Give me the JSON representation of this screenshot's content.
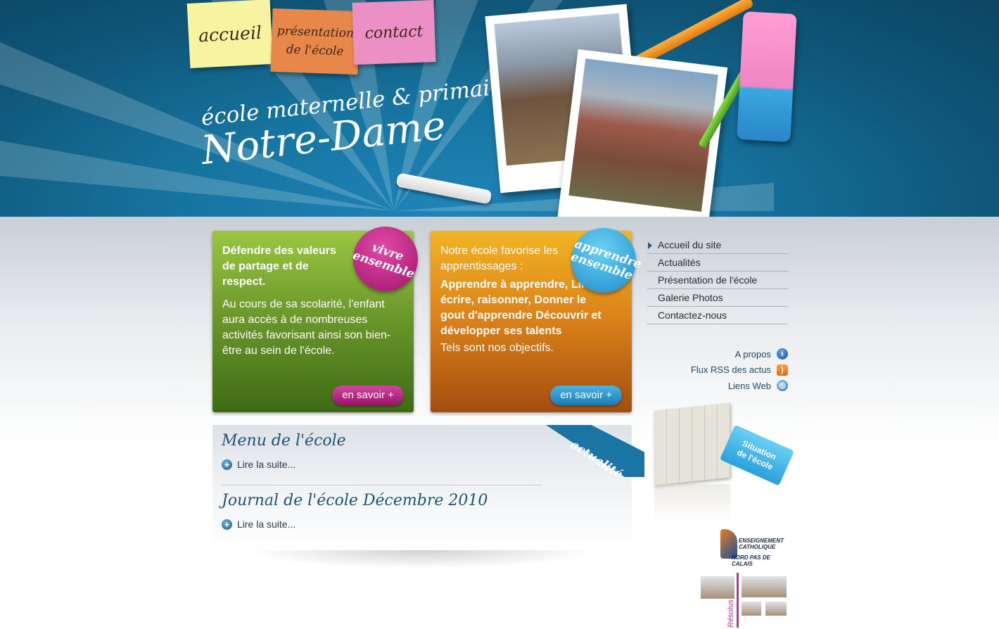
{
  "nav_notes": [
    {
      "label": "accueil"
    },
    {
      "label_line1": "présentation",
      "label_line2": "de l'école"
    },
    {
      "label": "contact"
    }
  ],
  "header": {
    "title_line1": "école maternelle & primaire",
    "title_line2": "Notre-Dame"
  },
  "features": {
    "green": {
      "seal_line1": "vivre",
      "seal_line2": "ensemble",
      "heading": "Défendre des valeurs de partage et de respect.",
      "body": "Au cours de sa scolarité, l'enfant aura accès à de nombreuses activités favorisant ainsi son bien-être au sein de l'école.",
      "button": "en savoir +"
    },
    "orange": {
      "seal_line1": "apprendre",
      "seal_line2": "ensemble",
      "intro": "Notre école favorise les apprentissages :",
      "points": "Apprendre à apprendre, Lire, écrire, raisonner, Donner le gout d'apprendre Découvrir et développer ses talents",
      "tail": "Tels sont nos objectifs.",
      "button": "en savoir +"
    }
  },
  "news": {
    "ribbon": "actualité",
    "items": [
      {
        "title": "Menu de l'école",
        "more": "Lire la suite..."
      },
      {
        "title": "Journal de l'école Décembre 2010",
        "more": "Lire la suite..."
      }
    ]
  },
  "sidebar": {
    "nav": [
      {
        "label": "Accueil du site"
      },
      {
        "label": "Actualités"
      },
      {
        "label": "Présentation de l'école"
      },
      {
        "label": "Galerie Photos"
      },
      {
        "label": "Contactez-nous"
      }
    ],
    "links": [
      {
        "label": "A propos",
        "icon": "info-icon"
      },
      {
        "label": "Flux RSS des actus",
        "icon": "rss-icon"
      },
      {
        "label": "Liens Web",
        "icon": "globe-icon"
      }
    ],
    "map_tag_line1": "Situation",
    "map_tag_line2": "de l'école",
    "logo_ec_line1": "ENSEIGNEMENT",
    "logo_ec_line2": "CATHOLIQUE",
    "logo_ec_line3": "NORD PAS DE CALAIS",
    "logo_res_text": "Résolus"
  }
}
